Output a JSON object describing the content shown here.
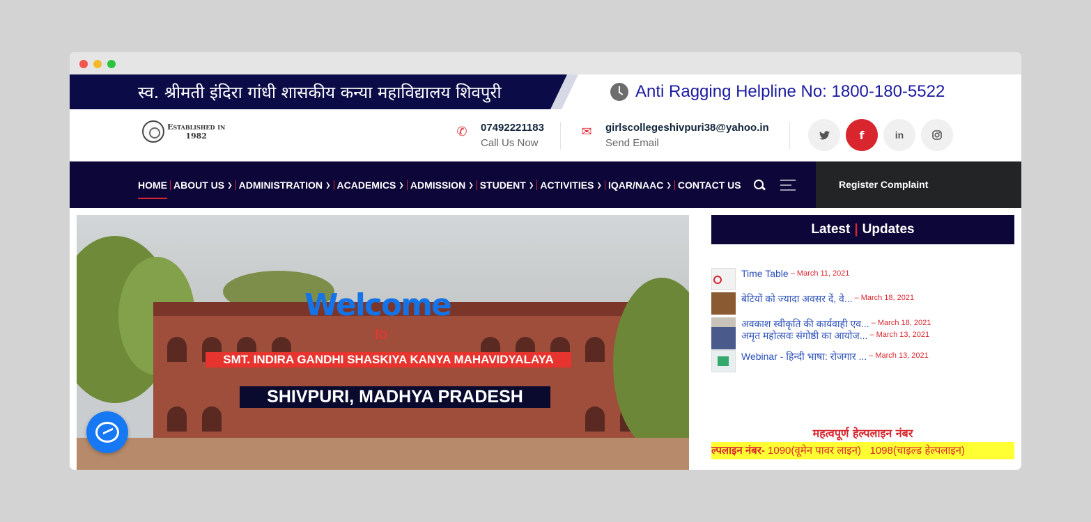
{
  "band": {
    "college_hindi": "स्व. श्रीमती इंदिरा गांधी शासकीय कन्या महाविद्यालय शिवपुरी",
    "helpline": "Anti Ragging Helpline No: 1800-180-5522"
  },
  "logo": {
    "line1": "Established in",
    "line2": "1982"
  },
  "contact": {
    "phone": "07492221183",
    "phone_sub": "Call Us Now",
    "email": "girlscollegeshivpuri38@yahoo.in",
    "email_sub": "Send Email"
  },
  "social": {
    "twitter": "t",
    "facebook": "f",
    "linkedin": "in",
    "instagram": "ig"
  },
  "nav": {
    "items": [
      "HOME",
      "ABOUT US",
      "ADMINISTRATION",
      "ACADEMICS",
      "ADMISSION",
      "STUDENT",
      "ACTIVITIES",
      "IQAR/NAAC",
      "CONTACT US"
    ],
    "register": "Register Complaint"
  },
  "hero": {
    "welcome": "Welcome",
    "to": "to",
    "college": "SMT. INDIRA GANDHI SHASKIYA KANYA MAHAVIDYALAYA",
    "city": "SHIVPURI, MADHYA PRADESH"
  },
  "updates": {
    "title_a": "Latest",
    "title_b": "Updates",
    "items": [
      {
        "text": "Time Table",
        "date": "– March 11, 2021"
      },
      {
        "text": "बेटियों को ज्यादा अवसर दें, वे...",
        "date": "– March 18, 2021"
      },
      {
        "text": "अवकाश स्वीकृति की कार्यवाही एव...",
        "date": "– March 18, 2021"
      },
      {
        "text": "अमृत महोत्सवः संगोष्ठी का आयोज...",
        "date": "– March 13, 2021"
      },
      {
        "text": "Webinar - हिन्दी भाषा: रोजगार ...",
        "date": "– March 13, 2021"
      }
    ],
    "important_title": "महत्वपूर्ण हेल्पलाइन नंबर",
    "marquee_label": "हेल्पलाइन नंबर-",
    "marquee_text": "1090(वूमेन पावर लाइन)   1098(चाइल्ड हेल्पलाइन)"
  }
}
